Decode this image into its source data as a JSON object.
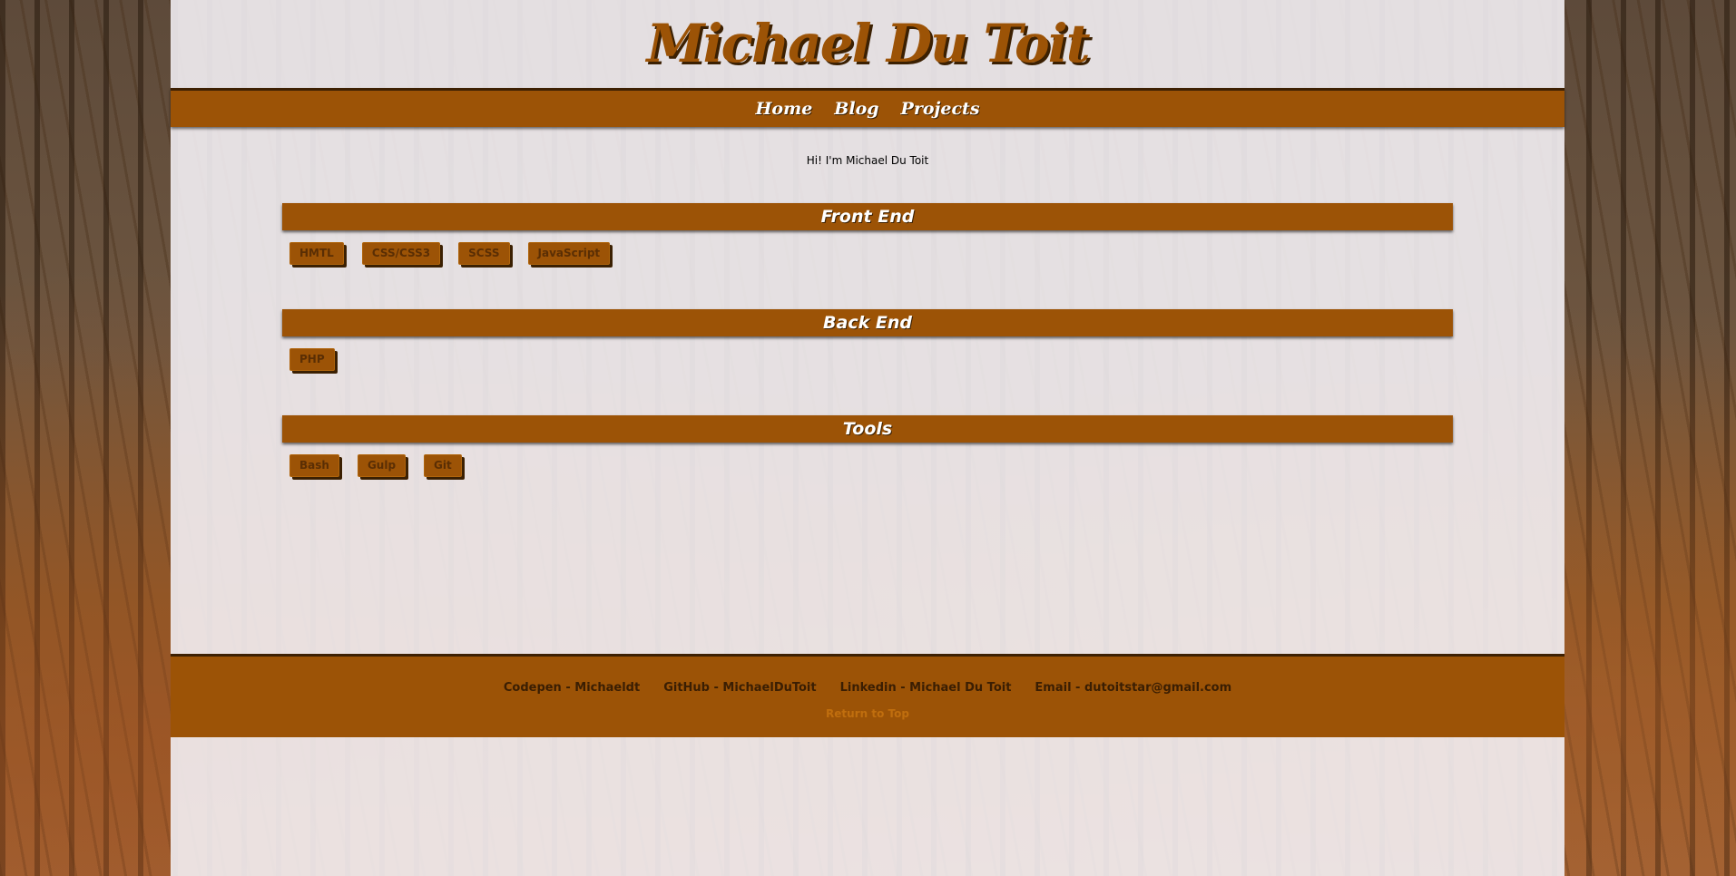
{
  "site": {
    "title": "Michael Du Toit"
  },
  "nav": {
    "items": [
      "Home",
      "Blog",
      "Projects"
    ]
  },
  "intro": "Hi! I'm Michael Du Toit",
  "sections": [
    {
      "title": "Front End",
      "skills": [
        "HMTL",
        "CSS/CSS3",
        "SCSS",
        "JavaScript"
      ]
    },
    {
      "title": "Back End",
      "skills": [
        "PHP"
      ]
    },
    {
      "title": "Tools",
      "skills": [
        "Bash",
        "Gulp",
        "Git"
      ]
    }
  ],
  "footer": {
    "links": [
      "Codepen - Michaeldt",
      "GitHub - MichaelDuToit",
      "Linkedin - Michael Du Toit",
      "Email - dutoitstar@gmail.com"
    ],
    "return_to_top": "Return to Top"
  },
  "colors": {
    "accent": "#9c5306",
    "dark": "#3b2002",
    "page": "#f3f0f4"
  }
}
